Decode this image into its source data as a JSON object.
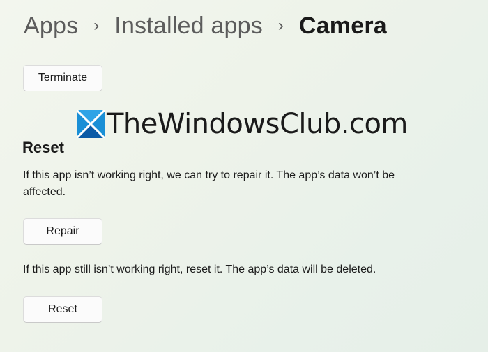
{
  "breadcrumb": {
    "items": [
      "Apps",
      "Installed apps",
      "Camera"
    ],
    "separator": "›"
  },
  "buttons": {
    "terminate": "Terminate",
    "repair": "Repair",
    "reset": "Reset"
  },
  "watermark": {
    "text": "TheWindowsClub.com",
    "logo_colors": {
      "blue": "#1a8fd6",
      "dark_blue": "#0b5aa6"
    }
  },
  "reset_section": {
    "title": "Reset",
    "repair_description": "If this app isn’t working right, we can try to repair it. The app’s data won’t be affected.",
    "reset_description": "If this app still isn’t working right, reset it. The app’s data will be deleted."
  },
  "icons": [
    "chevron-right-icon",
    "windows-club-logo-icon"
  ]
}
